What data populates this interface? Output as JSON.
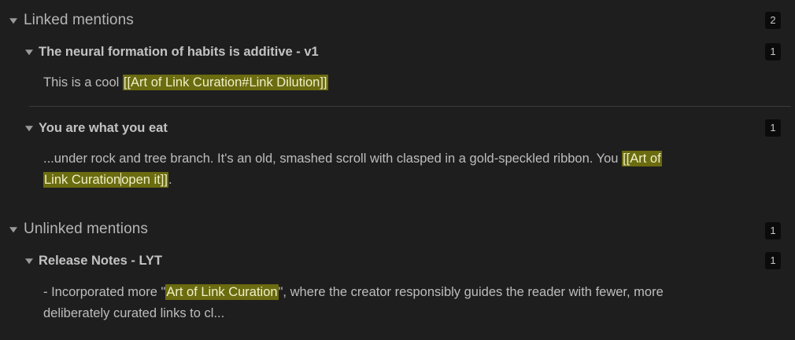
{
  "linked": {
    "title": "Linked mentions",
    "count": "2",
    "files": [
      {
        "title": "The neural formation of habits is additive - v1",
        "count": "1",
        "before": "This is a cool ",
        "link": "[[Art of Link Curation#Link Dilution]]",
        "after": ""
      },
      {
        "title": "You are what you eat",
        "count": "1",
        "before": "...under rock and tree branch. It's an old, smashed scroll with clasped in a gold-speckled ribbon. You ",
        "link_part1": "[[Art of",
        "link_part2": "Link Curation",
        "link_part3": "open it]]",
        "after": "."
      }
    ]
  },
  "unlinked": {
    "title": "Unlinked mentions",
    "count": "1",
    "files": [
      {
        "title": "Release Notes - LYT",
        "count": "1",
        "before": "- Incorporated more \"",
        "link": "Art of Link Curation",
        "after_line1": "\", where the creator responsibly guides the reader with fewer, more",
        "after_line2": "deliberately curated links to cl..."
      }
    ]
  },
  "colors": {
    "background": "#1e1e1e",
    "highlight": "#6b6b10",
    "badge": "#0b0b0b"
  }
}
